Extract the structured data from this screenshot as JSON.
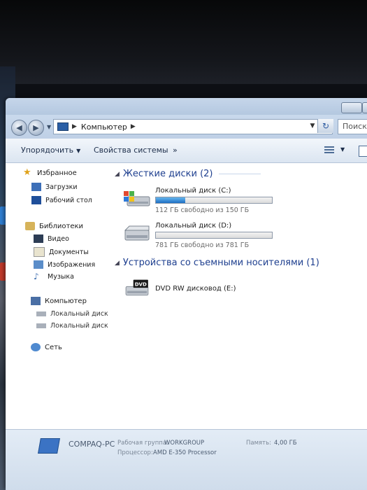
{
  "window": {
    "breadcrumb": "Компьютер",
    "search_placeholder": "Поиск: К"
  },
  "toolbar": {
    "organize": "Упорядочить",
    "system_properties": "Свойства системы",
    "more": "»"
  },
  "sidebar": {
    "favorites": {
      "label": "Избранное",
      "items": [
        {
          "label": "Загрузки"
        },
        {
          "label": "Рабочий стол"
        }
      ]
    },
    "libraries": {
      "label": "Библиотеки",
      "items": [
        {
          "label": "Видео"
        },
        {
          "label": "Документы"
        },
        {
          "label": "Изображения"
        },
        {
          "label": "Музыка"
        }
      ]
    },
    "computer": {
      "label": "Компьютер",
      "items": [
        {
          "label": "Локальный диск (С"
        },
        {
          "label": "Локальный диск (D"
        }
      ]
    },
    "network": {
      "label": "Сеть"
    }
  },
  "content": {
    "hard_drives": {
      "header": "Жесткие диски (2)",
      "drives": [
        {
          "name": "Локальный диск (C:)",
          "free_text": "112 ГБ свободно из 150 ГБ",
          "used_fraction": 0.25,
          "icon": "windows-drive-icon"
        },
        {
          "name": "Локальный диск (D:)",
          "free_text": "781 ГБ свободно из 781 ГБ",
          "used_fraction": 0.0,
          "icon": "hard-drive-icon"
        }
      ]
    },
    "removable": {
      "header": "Устройства со съемными носителями (1)",
      "devices": [
        {
          "name": "DVD RW дисковод (E:)",
          "icon": "dvd-drive-icon",
          "icon_text": "DVD"
        }
      ]
    }
  },
  "details": {
    "computer_name": "COMPAQ-PC",
    "workgroup_label": "Рабочая группа:",
    "workgroup_value": "WORKGROUP",
    "memory_label": "Память:",
    "memory_value": "4,00 ГБ",
    "processor_label": "Процессор:",
    "processor_value": "AMD E-350 Processor"
  },
  "colors": {
    "accent": "#1e3f8f",
    "bar_fill": "#1e6fc4"
  }
}
